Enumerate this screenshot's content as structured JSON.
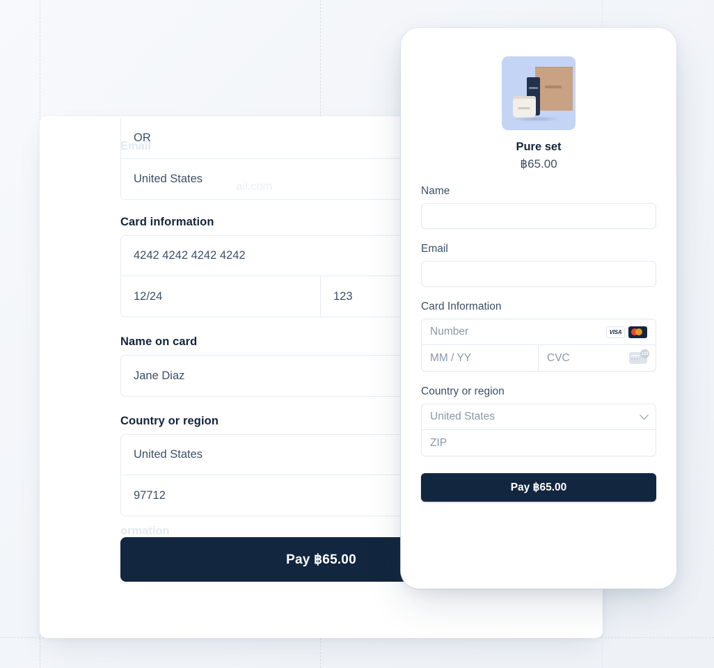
{
  "background": {
    "accent": "#12263f",
    "surface": "#ffffff",
    "canvas": "#f4f7fa",
    "guide_color": "#d3dae2"
  },
  "desktop_form": {
    "top_group": {
      "rows": [
        {
          "value": "OR"
        },
        {
          "value": "United States"
        }
      ]
    },
    "card_information": {
      "label": "Card information",
      "number": "4242 4242 4242 4242",
      "expiry": "12/24",
      "cvc": "123"
    },
    "name_on_card": {
      "label": "Name on card",
      "value": "Jane Diaz"
    },
    "country_or_region": {
      "label": "Country or region",
      "country": "United States",
      "zip": "97712"
    },
    "pay_button": "Pay ฿65.00",
    "ghost_text": {
      "email_label": "Email",
      "email_value": "ail.com",
      "card_information": "ormation"
    }
  },
  "mobile_panel": {
    "product": {
      "image_alt": "Pure set product box, tube and jar",
      "name": "Pure set",
      "price": "฿65.00"
    },
    "fields": {
      "name_label": "Name",
      "name_value": "",
      "name_placeholder": "",
      "email_label": "Email",
      "email_value": "",
      "email_placeholder": "",
      "card_information_label": "Card Information",
      "number_placeholder": "Number",
      "expiry_placeholder": "MM / YY",
      "cvc_placeholder": "CVC",
      "country_label": "Country or region",
      "country_value": "United States",
      "zip_placeholder": "ZIP"
    },
    "card_brands": {
      "visa": "VISA",
      "mastercard": "mastercard-icon",
      "cvc_hint": "123"
    },
    "pay_button": "Pay ฿65.00"
  }
}
